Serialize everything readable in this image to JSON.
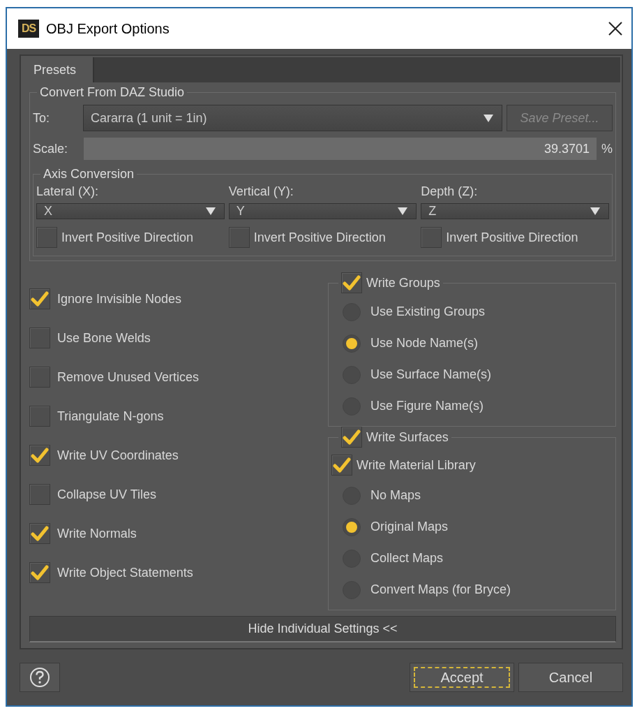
{
  "window": {
    "title": "OBJ Export Options",
    "logo": "DS"
  },
  "tabs": [
    {
      "label": "Presets",
      "selected": true
    }
  ],
  "convert_group": {
    "title": "Convert From DAZ Studio",
    "to": {
      "label": "To:",
      "value": "Cararra (1 unit = 1in)"
    },
    "save_preset": {
      "label": "Save Preset...",
      "disabled": true
    },
    "scale": {
      "label": "Scale:",
      "value": "39.3701",
      "unit": "%"
    }
  },
  "axis_conversion": {
    "title": "Axis Conversion",
    "axes": [
      {
        "label": "Lateral (X):",
        "value": "X",
        "invert_label": "Invert Positive Direction",
        "checked": false
      },
      {
        "label": "Vertical (Y):",
        "value": "Y",
        "invert_label": "Invert Positive Direction",
        "checked": false
      },
      {
        "label": "Depth (Z):",
        "value": "Z",
        "invert_label": "Invert Positive Direction",
        "checked": false
      }
    ]
  },
  "options": [
    {
      "label": "Ignore Invisible Nodes",
      "checked": true
    },
    {
      "label": "Use Bone Welds",
      "checked": false
    },
    {
      "label": "Remove Unused Vertices",
      "checked": false
    },
    {
      "label": "Triangulate N-gons",
      "checked": false
    },
    {
      "label": "Write UV Coordinates",
      "checked": true
    },
    {
      "label": "Collapse UV Tiles",
      "checked": false
    },
    {
      "label": "Write Normals",
      "checked": true
    },
    {
      "label": "Write Object Statements",
      "checked": true
    }
  ],
  "write_groups": {
    "label": "Write Groups",
    "checked": true,
    "items": [
      {
        "kind": "radio",
        "label": "Use Existing Groups",
        "selected": false
      },
      {
        "kind": "radio",
        "label": "Use Node Name(s)",
        "selected": true
      },
      {
        "kind": "radio",
        "label": "Use Surface Name(s)",
        "selected": false
      },
      {
        "kind": "radio",
        "label": "Use Figure Name(s)",
        "selected": false
      }
    ]
  },
  "write_surfaces": {
    "label": "Write Surfaces",
    "checked": true,
    "items": [
      {
        "kind": "checkbox",
        "label": "Write Material Library",
        "checked": true
      },
      {
        "kind": "radio",
        "label": "No Maps",
        "selected": false
      },
      {
        "kind": "radio",
        "label": "Original Maps",
        "selected": true
      },
      {
        "kind": "radio",
        "label": "Collect Maps",
        "selected": false
      },
      {
        "kind": "radio",
        "label": "Convert Maps (for Bryce)",
        "selected": false
      }
    ]
  },
  "toggle_button": "Hide Individual Settings <<",
  "buttons": [
    {
      "label": "Accept",
      "focused": true
    },
    {
      "label": "Cancel",
      "focused": false
    }
  ]
}
